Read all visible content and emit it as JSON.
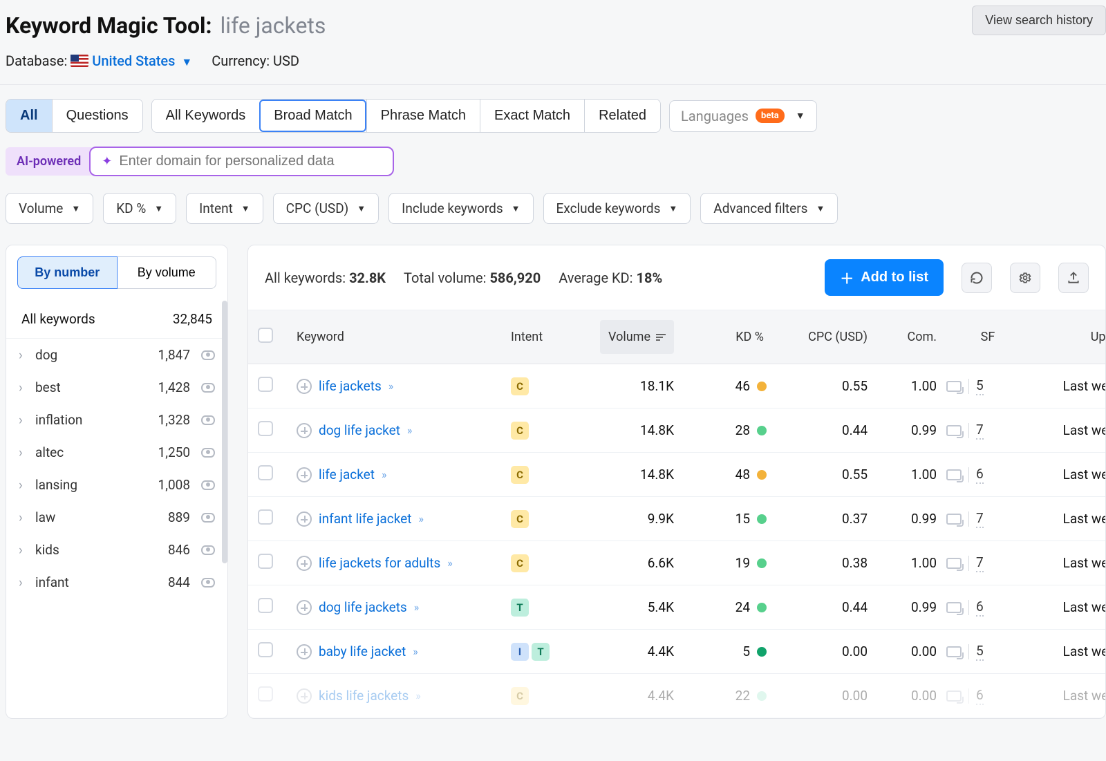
{
  "header": {
    "title": "Keyword Magic Tool:",
    "query": "life jackets",
    "history_btn": "View search history",
    "database_label": "Database:",
    "country": "United States",
    "currency_label": "Currency: USD"
  },
  "tabs_primary": {
    "all": "All",
    "questions": "Questions"
  },
  "tabs_match": {
    "all_keywords": "All Keywords",
    "broad": "Broad Match",
    "phrase": "Phrase Match",
    "exact": "Exact Match",
    "related": "Related"
  },
  "languages": {
    "label": "Languages",
    "badge": "beta"
  },
  "ai": {
    "chip": "AI-powered",
    "placeholder": "Enter domain for personalized data"
  },
  "drops": {
    "volume": "Volume",
    "kd": "KD %",
    "intent": "Intent",
    "cpc": "CPC (USD)",
    "include": "Include keywords",
    "exclude": "Exclude keywords",
    "advanced": "Advanced filters"
  },
  "sidebar": {
    "by_number": "By number",
    "by_volume": "By volume",
    "all_label": "All keywords",
    "all_count": "32,845",
    "items": [
      {
        "name": "dog",
        "count": "1,847"
      },
      {
        "name": "best",
        "count": "1,428"
      },
      {
        "name": "inflation",
        "count": "1,328"
      },
      {
        "name": "altec",
        "count": "1,250"
      },
      {
        "name": "lansing",
        "count": "1,008"
      },
      {
        "name": "law",
        "count": "889"
      },
      {
        "name": "kids",
        "count": "846"
      },
      {
        "name": "infant",
        "count": "844"
      }
    ]
  },
  "summary": {
    "all_label": "All keywords:",
    "all_val": "32.8K",
    "vol_label": "Total volume:",
    "vol_val": "586,920",
    "kd_label": "Average KD:",
    "kd_val": "18%",
    "add_btn": "Add to list"
  },
  "columns": {
    "keyword": "Keyword",
    "intent": "Intent",
    "volume": "Volume",
    "kd": "KD %",
    "cpc": "CPC (USD)",
    "com": "Com.",
    "sf": "SF",
    "updated": "Updated"
  },
  "rows": [
    {
      "kw": "life jackets",
      "intents": [
        "C"
      ],
      "vol": "18.1K",
      "kd": "46",
      "kd_dot": "orange",
      "cpc": "0.55",
      "com": "1.00",
      "sf": "5",
      "updated": "Last week"
    },
    {
      "kw": "dog life jacket",
      "intents": [
        "C"
      ],
      "vol": "14.8K",
      "kd": "28",
      "kd_dot": "green",
      "cpc": "0.44",
      "com": "0.99",
      "sf": "7",
      "updated": "Last week"
    },
    {
      "kw": "life jacket",
      "intents": [
        "C"
      ],
      "vol": "14.8K",
      "kd": "48",
      "kd_dot": "orange",
      "cpc": "0.55",
      "com": "1.00",
      "sf": "6",
      "updated": "Last week"
    },
    {
      "kw": "infant life jacket",
      "intents": [
        "C"
      ],
      "vol": "9.9K",
      "kd": "15",
      "kd_dot": "green",
      "cpc": "0.37",
      "com": "0.99",
      "sf": "7",
      "updated": "Last week"
    },
    {
      "kw": "life jackets for adults",
      "intents": [
        "C"
      ],
      "vol": "6.6K",
      "kd": "19",
      "kd_dot": "green",
      "cpc": "0.38",
      "com": "1.00",
      "sf": "7",
      "updated": "Last week"
    },
    {
      "kw": "dog life jackets",
      "intents": [
        "T"
      ],
      "vol": "5.4K",
      "kd": "24",
      "kd_dot": "green",
      "cpc": "0.44",
      "com": "0.99",
      "sf": "6",
      "updated": "Last week"
    },
    {
      "kw": "baby life jacket",
      "intents": [
        "I",
        "T"
      ],
      "vol": "4.4K",
      "kd": "5",
      "kd_dot": "dgreen",
      "cpc": "0.00",
      "com": "0.00",
      "sf": "5",
      "updated": "Last week"
    },
    {
      "kw": "kids life jackets",
      "intents": [
        "C"
      ],
      "vol": "4.4K",
      "kd": "22",
      "kd_dot": "lgreen",
      "cpc": "0.00",
      "com": "0.00",
      "sf": "6",
      "updated": "Last week",
      "faded": true
    }
  ]
}
